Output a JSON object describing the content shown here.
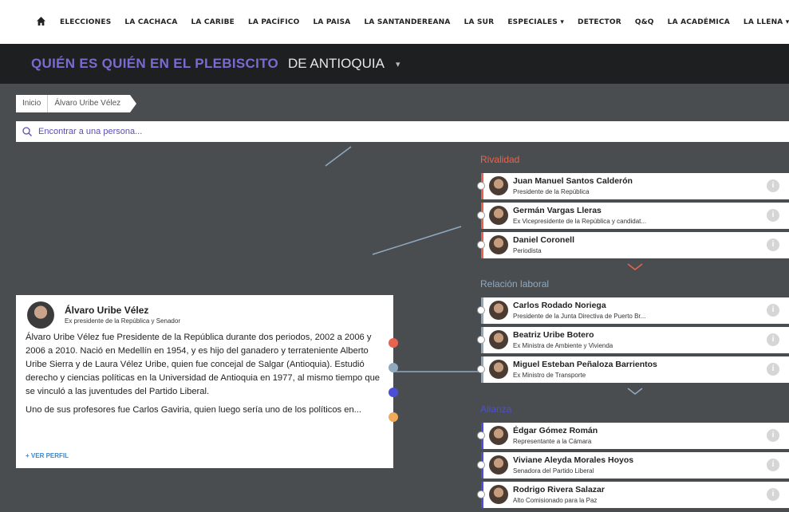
{
  "nav": {
    "home_icon": "home-icon",
    "items": [
      "ELECCIONES",
      "LA CACHACA",
      "LA CARIBE",
      "LA PACÍFICO",
      "LA PAISA",
      "LA SANTANDEREANA",
      "LA SUR",
      "ESPECIALES ▾",
      "DETECTOR",
      "Q&Q",
      "LA ACADÉMICA",
      "LA LLENA ▾"
    ]
  },
  "header": {
    "title": "QUIÉN ES QUIÉN EN EL PLEBISCITO",
    "region": "DE ANTIOQUIA",
    "caret": "▾"
  },
  "breadcrumb": {
    "home": "Inicio",
    "current": "Álvaro Uribe Vélez"
  },
  "search": {
    "placeholder": "Encontrar a una persona..."
  },
  "profile": {
    "name": "Álvaro Uribe Vélez",
    "role": "Ex presidente de la República y Senador",
    "bio1": "Álvaro Uribe Vélez fue Presidente de la República durante dos periodos, 2002 a 2006 y 2006 a 2010. Nació en Medellín en 1954, y es hijo del ganadero y terrateniente Alberto Uribe Sierra y de Laura Vélez Uribe, quien fue concejal de Salgar (Antioquia). Estudió derecho y ciencias políticas en la Universidad de Antioquia en 1977, al mismo tiempo que se vinculó a las juventudes del Partido Liberal.",
    "bio2": "Uno de sus profesores fue Carlos Gaviria, quien luego sería uno de los políticos en...",
    "more": "+ VER PERFIL"
  },
  "colors": {
    "rivalidad": "#e8634f",
    "laboral": "#8fa9c0",
    "alianza": "#4a4fd8",
    "extra": "#f1a95a"
  },
  "sections": [
    {
      "title": "Rivalidad",
      "color": "#e8634f",
      "people": [
        {
          "name": "Juan Manuel Santos Calderón",
          "role": "Presidente de la República"
        },
        {
          "name": "Germán Vargas Lleras",
          "role": "Ex Vicepresidente de la República y candidat..."
        },
        {
          "name": "Daniel Coronell",
          "role": "Periodista"
        }
      ]
    },
    {
      "title": "Relación laboral",
      "color": "#8fa9c0",
      "people": [
        {
          "name": "Carlos Rodado Noriega",
          "role": "Presidente de la Junta Directiva de Puerto Br..."
        },
        {
          "name": "Beatriz Uribe Botero",
          "role": "Ex Ministra de Ambiente y Vivienda"
        },
        {
          "name": "Miguel Esteban Peñaloza Barrientos",
          "role": "Ex Ministro de Transporte"
        }
      ]
    },
    {
      "title": "Alianza",
      "color": "#4a4fd8",
      "people": [
        {
          "name": "Édgar Gómez Román",
          "role": "Representante a la Cámara"
        },
        {
          "name": "Viviane Aleyda Morales Hoyos",
          "role": "Senadora del Partido Liberal"
        },
        {
          "name": "Rodrigo Rivera Salazar",
          "role": "Alto Comisionado para la Paz"
        }
      ]
    }
  ],
  "info_glyph": "i"
}
